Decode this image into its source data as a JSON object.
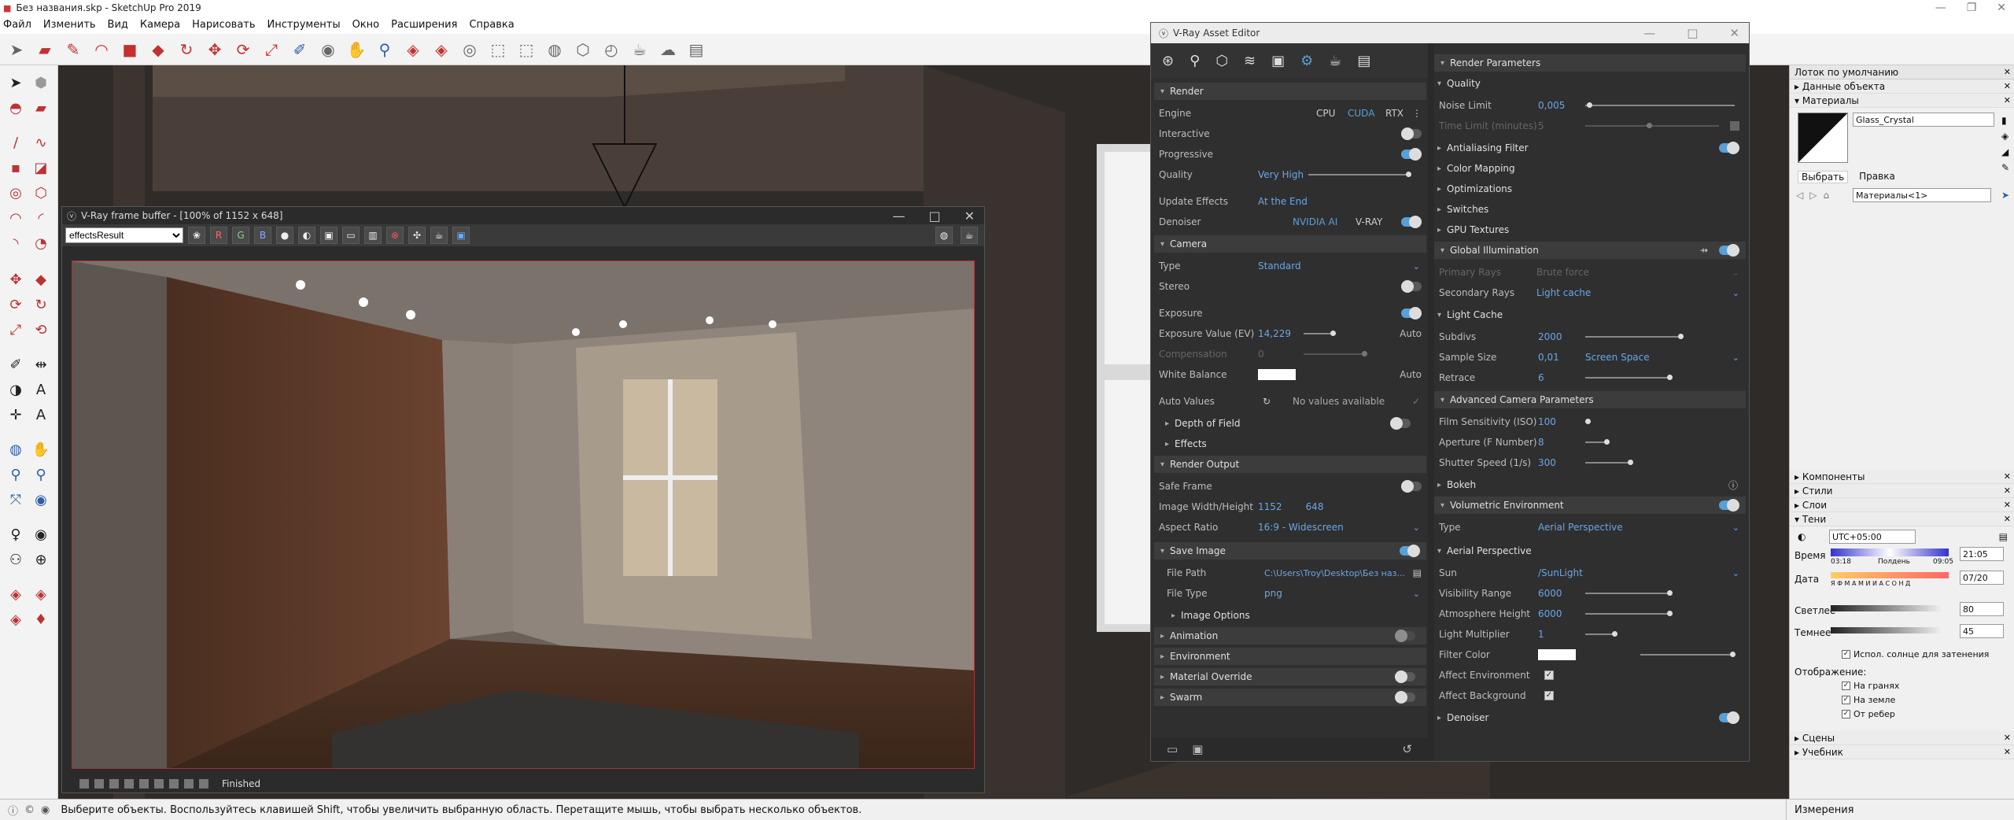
{
  "app": {
    "title": "Без названия.skp - SketchUp Pro 2019"
  },
  "menu": [
    "Файл",
    "Изменить",
    "Вид",
    "Камера",
    "Нарисовать",
    "Инструменты",
    "Окно",
    "Расширения",
    "Справка"
  ],
  "status": {
    "text": "Выберите объекты. Воспользуйтесь клавишей Shift, чтобы увеличить выбранную область. Перетащите мышь, чтобы выбрать несколько объектов.",
    "measure_label": "Измерения"
  },
  "vfb": {
    "title": "V-Ray frame buffer - [100% of 1152 x 648]",
    "channel": "effectsResult",
    "buttons": [
      "R",
      "G",
      "B"
    ],
    "status": "Finished"
  },
  "ae": {
    "title": "V-Ray Asset Editor",
    "left": {
      "render_header": "Render",
      "engine_label": "Engine",
      "engine_opts": [
        "CPU",
        "CUDA",
        "RTX"
      ],
      "interactive": "Interactive",
      "progressive": "Progressive",
      "quality_label": "Quality",
      "quality_val": "Very High",
      "update_label": "Update Effects",
      "update_val": "At the End",
      "denoiser_label": "Denoiser",
      "denoiser_opts": [
        "NVIDIA AI",
        "V-RAY"
      ],
      "camera_header": "Camera",
      "type_label": "Type",
      "type_val": "Standard",
      "stereo": "Stereo",
      "exposure": "Exposure",
      "ev_label": "Exposure Value (EV)",
      "ev_val": "14,229",
      "auto": "Auto",
      "comp_label": "Compensation",
      "comp_val": "0",
      "wb_label": "White Balance",
      "autovals_label": "Auto Values",
      "autovals_val": "No values available",
      "dof": "Depth of Field",
      "effects": "Effects",
      "ro_header": "Render Output",
      "safe": "Safe Frame",
      "size_label": "Image Width/Height",
      "width": "1152",
      "height": "648",
      "aspect_label": "Aspect Ratio",
      "aspect_val": "16:9 - Widescreen",
      "save": "Save Image",
      "path_label": "File Path",
      "path_val": "C:\\Users\\Troy\\Desktop\\Без наз...",
      "ftype_label": "File Type",
      "ftype_val": "png",
      "imgopts": "Image Options",
      "animation": "Animation",
      "environment": "Environment",
      "matoverride": "Material Override",
      "swarm": "Swarm"
    },
    "right": {
      "rp_header": "Render Parameters",
      "quality_header": "Quality",
      "noise_label": "Noise Limit",
      "noise_val": "0,005",
      "tl_label": "Time Limit (minutes)",
      "tl_val": "5",
      "aa": "Antialiasing Filter",
      "cm": "Color Mapping",
      "opt": "Optimizations",
      "sw": "Switches",
      "gpu": "GPU Textures",
      "gi": "Global Illumination",
      "pr_label": "Primary Rays",
      "pr_val": "Brute force",
      "sr_label": "Secondary Rays",
      "sr_val": "Light cache",
      "lc": "Light Cache",
      "subdivs_label": "Subdivs",
      "subdivs_val": "2000",
      "ss_label": "Sample Size",
      "ss_val": "0,01",
      "ss_mode": "Screen Space",
      "retrace_label": "Retrace",
      "retrace_val": "6",
      "acp": "Advanced Camera Parameters",
      "iso_label": "Film Sensitivity (ISO)",
      "iso_val": "100",
      "ap_label": "Aperture (F Number)",
      "ap_val": "8",
      "sh_label": "Shutter Speed (1/s)",
      "sh_val": "300",
      "bokeh": "Bokeh",
      "ve": "Volumetric Environment",
      "ve_type_label": "Type",
      "ve_type_val": "Aerial Perspective",
      "ap_header": "Aerial Perspective",
      "sun_label": "Sun",
      "sun_val": "/SunLight",
      "vis_label": "Visibility Range",
      "vis_val": "6000",
      "ah_label": "Atmosphere Height",
      "ah_val": "6000",
      "lm_label": "Light Multiplier",
      "lm_val": "1",
      "fc_label": "Filter Color",
      "aenv": "Affect Environment",
      "abg": "Affect Background",
      "den": "Denoiser"
    }
  },
  "tray": {
    "title": "Лоток по умолчанию",
    "entity": "Данные объекта",
    "materials": "Материалы",
    "mat_name": "Glass_Crystal",
    "tabs": [
      "Выбрать",
      "Правка"
    ],
    "mat_list": "Материалы<1>",
    "components": "Компоненты",
    "styles": "Стили",
    "layers": "Слои",
    "shadows": "Тени",
    "tz": "UTC+05:00",
    "time_label": "Время",
    "time_a": "03:18",
    "time_b": "Полдень",
    "time_c": "09:05",
    "time_val": "21:05",
    "date_label": "Дата",
    "months": "Я Ф М А М И И А С О Н Д",
    "date_val": "07/20",
    "light_label": "Светлее",
    "light_val": "80",
    "dark_label": "Темнее",
    "dark_val": "45",
    "sun_shading": "Испол. солнце для затенения",
    "display": "Отображение:",
    "faces": "На гранях",
    "ground": "На земле",
    "edges": "От ребер",
    "scenes": "Сцены",
    "instructor": "Учебник"
  }
}
